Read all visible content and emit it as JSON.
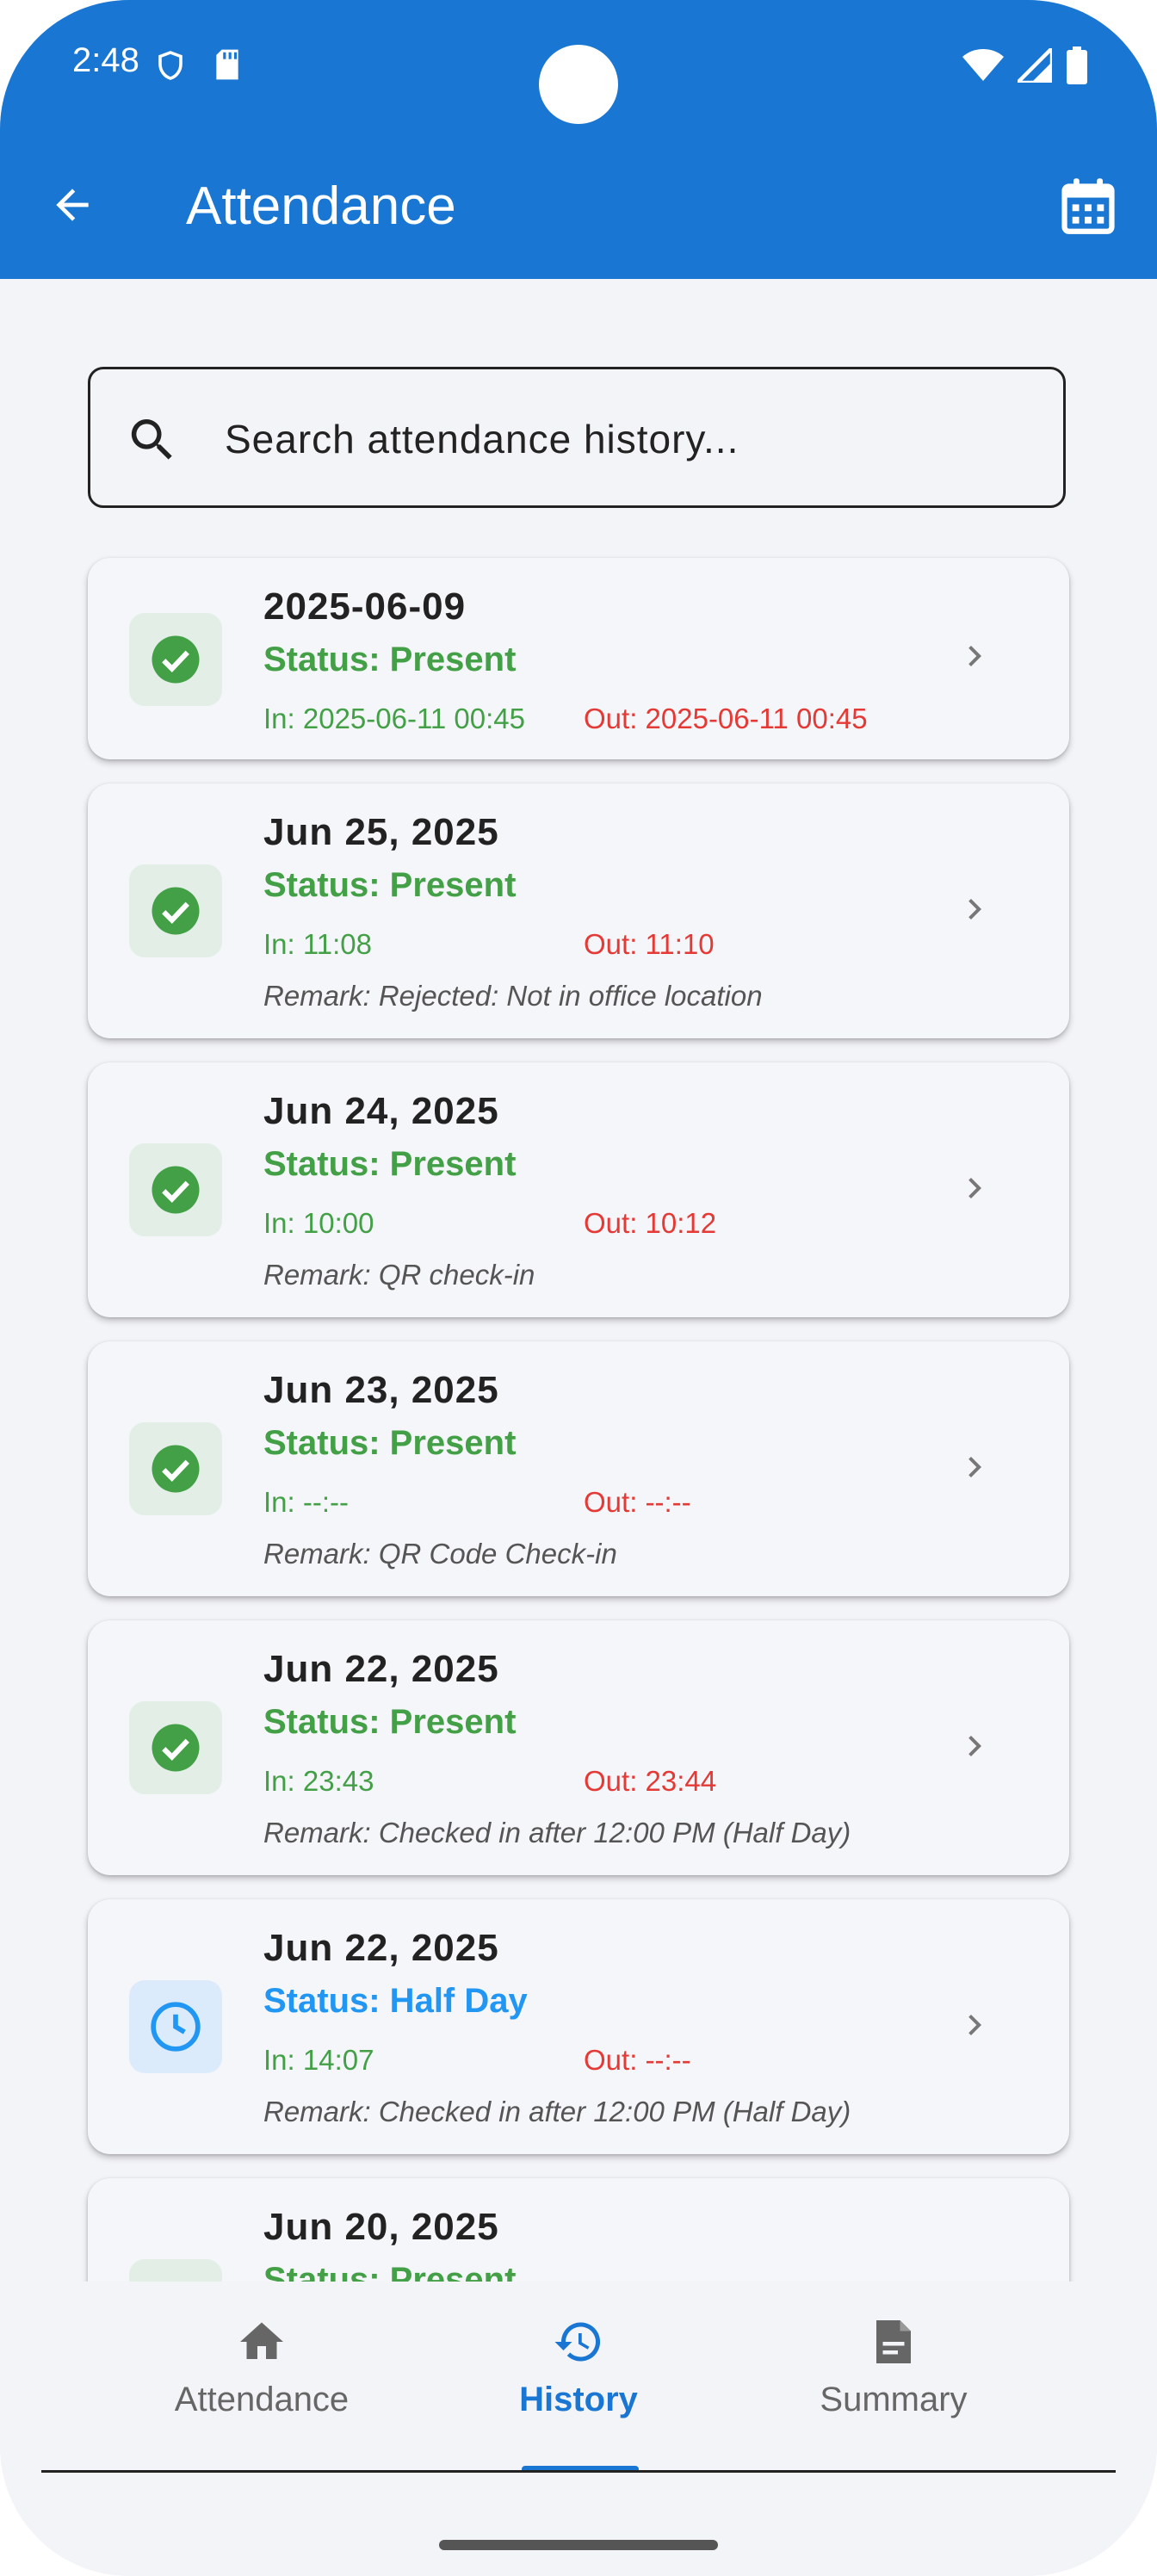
{
  "status_bar": {
    "time": "2:48"
  },
  "app_bar": {
    "title": "Attendance"
  },
  "search": {
    "placeholder": "Search attendance history..."
  },
  "records": [
    {
      "date": "2025-06-09",
      "status": "Status: Present",
      "type": "present",
      "in": "In: 2025-06-11  00:45",
      "out": "Out: 2025-06-11  00:45",
      "remark": ""
    },
    {
      "date": "Jun 25, 2025",
      "status": "Status: Present",
      "type": "present",
      "in": "In: 11:08",
      "out": "Out: 11:10",
      "remark": "Remark: Rejected: Not in office location"
    },
    {
      "date": "Jun 24, 2025",
      "status": "Status: Present",
      "type": "present",
      "in": "In: 10:00",
      "out": "Out: 10:12",
      "remark": "Remark: QR check-in"
    },
    {
      "date": "Jun 23, 2025",
      "status": "Status: Present",
      "type": "present",
      "in": "In: --:--",
      "out": "Out: --:--",
      "remark": "Remark: QR Code Check-in"
    },
    {
      "date": "Jun 22, 2025",
      "status": "Status: Present",
      "type": "present",
      "in": "In: 23:43",
      "out": "Out: 23:44",
      "remark": "Remark: Checked in after 12:00 PM (Half Day)"
    },
    {
      "date": "Jun 22, 2025",
      "status": "Status: Half Day",
      "type": "halfday",
      "in": "In: 14:07",
      "out": "Out: --:--",
      "remark": "Remark: Checked in after 12:00 PM (Half Day)"
    },
    {
      "date": "Jun 20, 2025",
      "status": "Status: Present",
      "type": "present",
      "in": "",
      "out": "",
      "remark": ""
    }
  ],
  "bottom_nav": {
    "items": [
      {
        "label": "Attendance",
        "icon": "home-icon",
        "active": false
      },
      {
        "label": "History",
        "icon": "history-icon",
        "active": true
      },
      {
        "label": "Summary",
        "icon": "document-icon",
        "active": false
      }
    ]
  },
  "colors": {
    "primary": "#1976d2",
    "present": "#43a047",
    "halfday": "#2196f3",
    "out": "#e53935"
  }
}
